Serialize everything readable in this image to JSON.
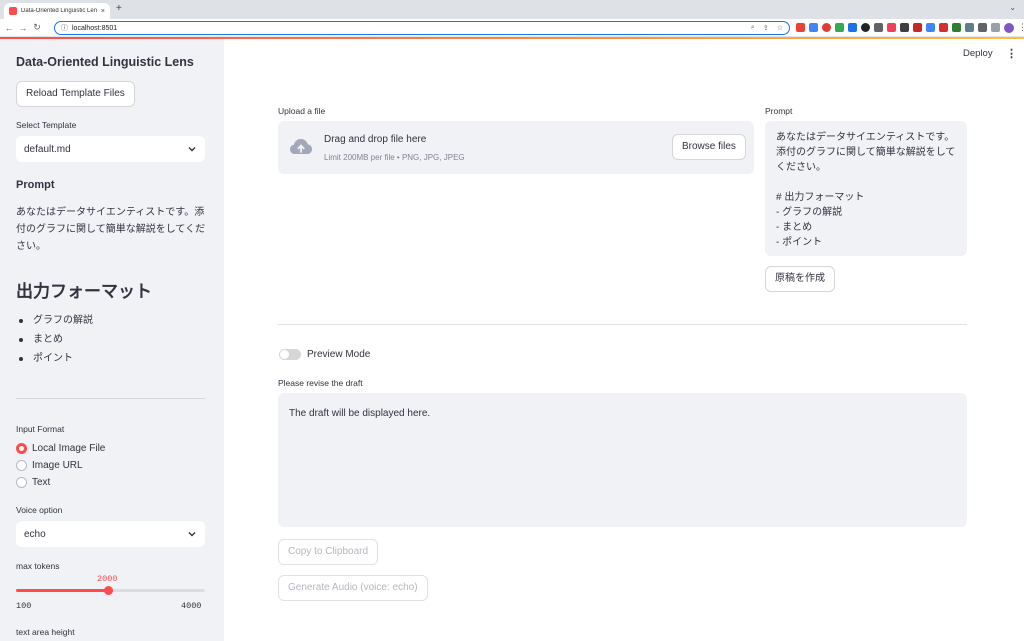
{
  "browser": {
    "tab_title": "Data-Oriented Linguistic Lens",
    "tab_close": "×",
    "new_tab": "+",
    "url": "localhost:8501"
  },
  "sidebar": {
    "app_title": "Data-Oriented Linguistic Lens",
    "reload_label": "Reload Template Files",
    "select_template_label": "Select Template",
    "selected_template": "default.md",
    "prompt_heading": "Prompt",
    "prompt_text": "あなたはデータサイエンティストです。添付のグラフに関して簡単な解説をしてください。",
    "output_heading": "出力フォーマット",
    "output_items": [
      "グラフの解説",
      "まとめ",
      "ポイント"
    ],
    "input_format_label": "Input Format",
    "input_formats": [
      {
        "label": "Local Image File",
        "selected": true
      },
      {
        "label": "Image URL",
        "selected": false
      },
      {
        "label": "Text",
        "selected": false
      }
    ],
    "voice_option_label": "Voice option",
    "voice_selected": "echo",
    "max_tokens_label": "max tokens",
    "max_tokens": {
      "value": "2000",
      "min": "100",
      "max": "4000",
      "fraction": 0.4872
    },
    "text_area_height_label": "text area height"
  },
  "main": {
    "deploy_label": "Deploy",
    "menu_glyph": "⋮",
    "upload": {
      "label": "Upload a file",
      "title": "Drag and drop file here",
      "subtitle": "Limit 200MB per file • PNG, JPG, JPEG",
      "browse_label": "Browse files"
    },
    "prompt": {
      "label": "Prompt",
      "text": "あなたはデータサイエンティストです。添付のグラフに関して簡単な解説をしてください。\n\n# 出力フォーマット\n- グラフの解説\n- まとめ\n- ポイント"
    },
    "create_draft_label": "原稿を作成",
    "preview_mode_label": "Preview Mode",
    "revise_label": "Please revise the draft",
    "draft_placeholder": "The draft will be displayed here.",
    "copy_label": "Copy to Clipboard",
    "generate_audio_label": "Generate Audio (voice: echo)"
  },
  "colors": {
    "accent": "#ff4b4b",
    "sidebar_bg": "#f0f2f6",
    "text": "#31333f"
  }
}
